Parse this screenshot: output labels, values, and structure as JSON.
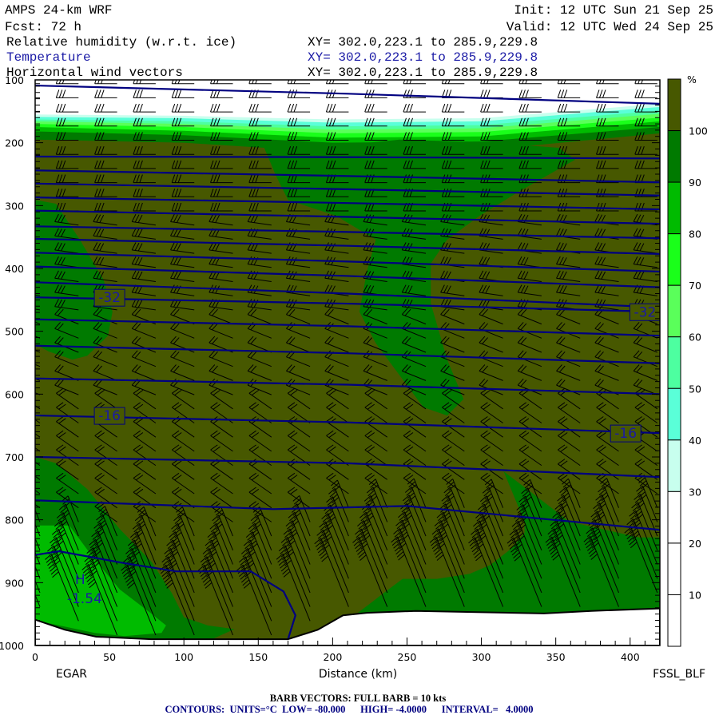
{
  "header": {
    "model": "AMPS 24-km WRF",
    "forecast": "Fcst:   72 h",
    "init": "Init: 12 UTC Sun 21 Sep 25",
    "valid": "Valid: 12 UTC Wed 24 Sep 25",
    "fields": [
      {
        "name": "Relative humidity (w.r.t. ice)",
        "xy": "XY= 302.0,223.1 to 285.9,229.8",
        "color": "#000000"
      },
      {
        "name": "Temperature",
        "xy": "XY= 302.0,223.1 to 285.9,229.8",
        "color": "#1a1aa6"
      },
      {
        "name": "Horizontal wind vectors",
        "xy": "XY= 302.0,223.1 to 285.9,229.8",
        "color": "#000000"
      }
    ]
  },
  "footer": {
    "barb_note": "BARB VECTORS:  FULL BARB = 10 kts",
    "contour_note": "CONTOURS:  UNITS=°C  LOW= -80.000      HIGH= -4.0000      INTERVAL=   4.0000"
  },
  "chart_data": {
    "type": "cross-section",
    "xlabel": "Distance (km)",
    "x_start_label": "EGAR",
    "x_end_label": "FSSL_BLF",
    "xlim": [
      0,
      420
    ],
    "ylim": [
      1000,
      100
    ],
    "x_ticks": [
      "0",
      "50",
      "100",
      "150",
      "200",
      "250",
      "300",
      "350",
      "400"
    ],
    "y_ticks": [
      "100",
      "200",
      "300",
      "400",
      "500",
      "600",
      "700",
      "800",
      "900",
      "1000"
    ],
    "colorbar": {
      "unit": "%",
      "labels": [
        "100",
        "90",
        "80",
        "70",
        "60",
        "50",
        "40",
        "30",
        "20",
        "10"
      ],
      "colors": [
        "#475800",
        "#007a00",
        "#00bb00",
        "#1aff1a",
        "#5aff5a",
        "#4dffa0",
        "#5affd8",
        "#c8ffee",
        "#ffffff",
        "#ffffff",
        "#ffffff"
      ]
    },
    "rh_top_km": [
      0,
      100,
      200,
      300,
      420
    ],
    "rh_top_boundaries": [
      {
        "level": 100,
        "color": "#007a00",
        "p": [
          195,
          200,
          215,
          212,
          185
        ]
      },
      {
        "level": 90,
        "color": "#00bb00",
        "p": [
          182,
          188,
          200,
          198,
          175
        ]
      },
      {
        "level": 80,
        "color": "#1aff1a",
        "p": [
          175,
          181,
          192,
          190,
          166
        ]
      },
      {
        "level": 70,
        "color": "#5aff5a",
        "p": [
          170,
          175,
          185,
          183,
          160
        ]
      },
      {
        "level": 60,
        "color": "#4dffa0",
        "p": [
          166,
          170,
          179,
          177,
          154
        ]
      },
      {
        "level": 50,
        "color": "#5affd8",
        "p": [
          163,
          166,
          174,
          172,
          149
        ]
      },
      {
        "level": 40,
        "color": "#c8ffee",
        "p": [
          159,
          161,
          168,
          166,
          143
        ]
      },
      {
        "level": 30,
        "color": "#ffffff",
        "p": [
          155,
          157,
          163,
          161,
          138
        ]
      }
    ],
    "rh_regions": [
      {
        "range": "90-100",
        "color": "#007a00",
        "points": [
          [
            154,
            208
          ],
          [
            191,
            208
          ],
          [
            245,
            195
          ],
          [
            299,
            199
          ],
          [
            352,
            208
          ],
          [
            363,
            227
          ],
          [
            325,
            278
          ],
          [
            299,
            316
          ],
          [
            277,
            354
          ],
          [
            266,
            392
          ],
          [
            266,
            456
          ],
          [
            277,
            545
          ],
          [
            288,
            608
          ],
          [
            277,
            634
          ],
          [
            261,
            621
          ],
          [
            245,
            570
          ],
          [
            229,
            519
          ],
          [
            218,
            469
          ],
          [
            223,
            405
          ],
          [
            229,
            354
          ],
          [
            202,
            316
          ],
          [
            170,
            291
          ],
          [
            162,
            253
          ]
        ]
      },
      {
        "range": "90-100",
        "color": "#007a00",
        "points": [
          [
            0,
            291
          ],
          [
            14,
            297
          ],
          [
            30,
            354
          ],
          [
            46,
            418
          ],
          [
            52,
            469
          ],
          [
            49,
            507
          ],
          [
            35,
            539
          ],
          [
            25,
            545
          ],
          [
            9,
            532
          ],
          [
            0,
            520
          ]
        ]
      },
      {
        "range": "90-100",
        "color": "#007a00",
        "points": [
          [
            0,
            700
          ],
          [
            14,
            710
          ],
          [
            35,
            751
          ],
          [
            57,
            815
          ],
          [
            78,
            866
          ],
          [
            92,
            917
          ],
          [
            100,
            955
          ],
          [
            116,
            968
          ],
          [
            134,
            974
          ],
          [
            116,
            993
          ],
          [
            0,
            993
          ]
        ]
      },
      {
        "range": "80-90",
        "color": "#00bb00",
        "points": [
          [
            0,
            809
          ],
          [
            23,
            809
          ],
          [
            39,
            860
          ],
          [
            57,
            911
          ],
          [
            78,
            949
          ],
          [
            88,
            968
          ],
          [
            85,
            980
          ],
          [
            60,
            985
          ],
          [
            40,
            980
          ],
          [
            0,
            960
          ]
        ]
      },
      {
        "range": "90-100",
        "color": "#007a00",
        "points": [
          [
            315,
            723
          ],
          [
            345,
            777
          ],
          [
            359,
            803
          ],
          [
            406,
            828
          ],
          [
            420,
            828
          ],
          [
            420,
            941
          ],
          [
            374,
            945
          ],
          [
            342,
            949
          ],
          [
            256,
            945
          ],
          [
            223,
            948
          ],
          [
            213,
            955
          ],
          [
            227,
            930
          ],
          [
            234,
            917
          ],
          [
            247,
            894
          ],
          [
            270,
            894
          ],
          [
            292,
            886
          ],
          [
            306,
            872
          ],
          [
            320,
            846
          ],
          [
            329,
            821
          ],
          [
            329,
            803
          ]
        ]
      }
    ],
    "surface_pressure": [
      [
        0,
        959
      ],
      [
        20,
        975
      ],
      [
        41,
        986
      ],
      [
        78,
        990
      ],
      [
        170,
        990
      ],
      [
        190,
        975
      ],
      [
        207,
        952
      ],
      [
        223,
        948
      ],
      [
        256,
        945
      ],
      [
        342,
        949
      ],
      [
        374,
        945
      ],
      [
        420,
        941
      ]
    ],
    "isotherms": [
      {
        "temp": -76,
        "points": [
          [
            0,
            109
          ],
          [
            210,
            122
          ],
          [
            420,
            138
          ]
        ]
      },
      {
        "temp": -72,
        "points": [
          [
            0,
            222
          ],
          [
            210,
            223
          ],
          [
            420,
            225
          ]
        ]
      },
      {
        "temp": -68,
        "points": [
          [
            0,
            244
          ],
          [
            210,
            253
          ],
          [
            420,
            263
          ]
        ]
      },
      {
        "temp": -64,
        "points": [
          [
            0,
            265
          ],
          [
            210,
            274
          ],
          [
            420,
            284
          ]
        ]
      },
      {
        "temp": -60,
        "points": [
          [
            0,
            287
          ],
          [
            210,
            296
          ],
          [
            420,
            306
          ]
        ]
      },
      {
        "temp": -56,
        "points": [
          [
            0,
            308
          ],
          [
            210,
            318
          ],
          [
            420,
            329
          ]
        ]
      },
      {
        "temp": -52,
        "points": [
          [
            0,
            333
          ],
          [
            210,
            342
          ],
          [
            420,
            352
          ]
        ]
      },
      {
        "temp": -48,
        "points": [
          [
            0,
            353
          ],
          [
            210,
            364
          ],
          [
            420,
            377
          ]
        ]
      },
      {
        "temp": -44,
        "points": [
          [
            0,
            375
          ],
          [
            210,
            389
          ],
          [
            420,
            405
          ]
        ]
      },
      {
        "temp": -40,
        "points": [
          [
            0,
            397
          ],
          [
            210,
            412
          ],
          [
            420,
            430
          ]
        ]
      },
      {
        "temp": -36,
        "points": [
          [
            0,
            422
          ],
          [
            210,
            440
          ],
          [
            420,
            462
          ]
        ]
      },
      {
        "temp": -32,
        "points": [
          [
            0,
            446
          ],
          [
            210,
            456
          ],
          [
            420,
            469
          ]
        ]
      },
      {
        "temp": -28,
        "points": [
          [
            0,
            481
          ],
          [
            210,
            492
          ],
          [
            420,
            507
          ]
        ]
      },
      {
        "temp": -24,
        "points": [
          [
            0,
            523
          ],
          [
            210,
            535
          ],
          [
            420,
            551
          ]
        ]
      },
      {
        "temp": -20,
        "points": [
          [
            0,
            575
          ],
          [
            210,
            585
          ],
          [
            420,
            600
          ]
        ]
      },
      {
        "temp": -16,
        "points": [
          [
            0,
            634
          ],
          [
            210,
            645
          ],
          [
            420,
            662
          ]
        ]
      },
      {
        "temp": -12,
        "points": [
          [
            0,
            700
          ],
          [
            210,
            710
          ],
          [
            420,
            732
          ]
        ]
      },
      {
        "temp": -8,
        "points": [
          [
            0,
            769
          ],
          [
            160,
            783
          ],
          [
            250,
            778
          ],
          [
            420,
            816
          ]
        ]
      },
      {
        "temp": -4,
        "points": [
          [
            0,
            856
          ],
          [
            16,
            850
          ],
          [
            60,
            869
          ],
          [
            95,
            882
          ],
          [
            145,
            882
          ],
          [
            167,
            914
          ],
          [
            175,
            952
          ],
          [
            170,
            990
          ]
        ]
      }
    ],
    "contour_labels": [
      {
        "text": "-32",
        "km": 50,
        "p": 446
      },
      {
        "text": "-32",
        "km": 410,
        "p": 469
      },
      {
        "text": "-16",
        "km": 50,
        "p": 634
      },
      {
        "text": "-16",
        "km": 397,
        "p": 662
      }
    ],
    "extremum": {
      "symbol": "H",
      "value": "-1.54",
      "km": 30,
      "p": 925
    }
  }
}
